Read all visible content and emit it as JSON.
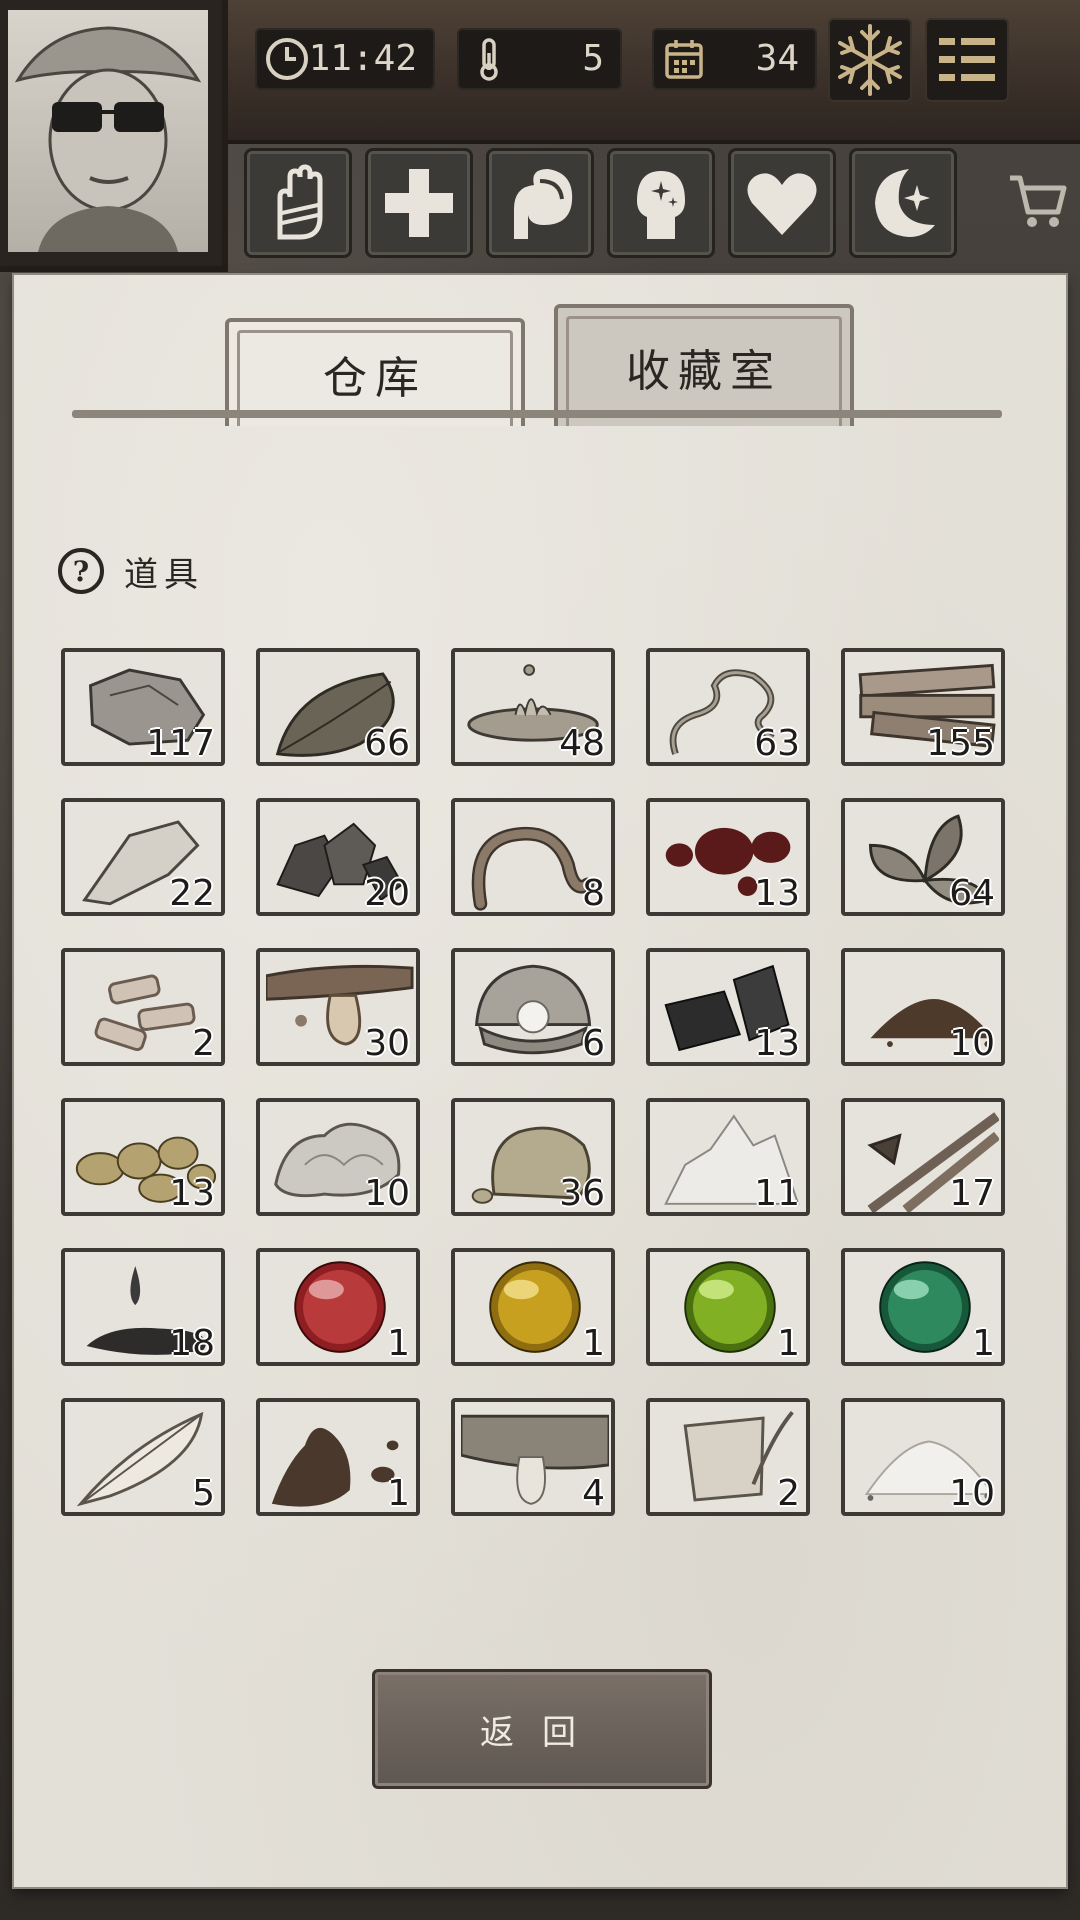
{
  "status_bar": {
    "time": "11:42",
    "temperature": "5",
    "day": "34",
    "season_icon": "snowflake-icon",
    "menu_icon": "menu-icon"
  },
  "status_buttons": [
    {
      "name": "hand-icon"
    },
    {
      "name": "health-cross-icon"
    },
    {
      "name": "stomach-icon"
    },
    {
      "name": "mind-icon"
    },
    {
      "name": "heart-icon"
    },
    {
      "name": "moon-star-icon"
    }
  ],
  "tabs": {
    "warehouse": "仓库",
    "collection": "收藏室"
  },
  "section": {
    "title": "道具",
    "help": "?"
  },
  "items": [
    {
      "name": "stone",
      "count": "117"
    },
    {
      "name": "leaf",
      "count": "66"
    },
    {
      "name": "water",
      "count": "48"
    },
    {
      "name": "vine",
      "count": "63"
    },
    {
      "name": "planks",
      "count": "155"
    },
    {
      "name": "flint",
      "count": "22"
    },
    {
      "name": "ore",
      "count": "20"
    },
    {
      "name": "worm",
      "count": "8"
    },
    {
      "name": "blood",
      "count": "13"
    },
    {
      "name": "herb",
      "count": "64"
    },
    {
      "name": "bone-fragments",
      "count": "2"
    },
    {
      "name": "resin",
      "count": "30"
    },
    {
      "name": "pearl",
      "count": "6"
    },
    {
      "name": "charcoal",
      "count": "13"
    },
    {
      "name": "dirt",
      "count": "10"
    },
    {
      "name": "gold-nuggets",
      "count": "13"
    },
    {
      "name": "cotton",
      "count": "10"
    },
    {
      "name": "sandstone",
      "count": "36"
    },
    {
      "name": "salt-crystals",
      "count": "11"
    },
    {
      "name": "bamboo-spears",
      "count": "17"
    },
    {
      "name": "oil",
      "count": "18"
    },
    {
      "name": "red-orb",
      "count": "1"
    },
    {
      "name": "yellow-orb",
      "count": "1"
    },
    {
      "name": "lime-orb",
      "count": "1"
    },
    {
      "name": "green-orb",
      "count": "1"
    },
    {
      "name": "feather",
      "count": "5"
    },
    {
      "name": "mud",
      "count": "1"
    },
    {
      "name": "fish-oil",
      "count": "4"
    },
    {
      "name": "scroll",
      "count": "2"
    },
    {
      "name": "powder",
      "count": "10"
    }
  ],
  "back_button": "返回"
}
